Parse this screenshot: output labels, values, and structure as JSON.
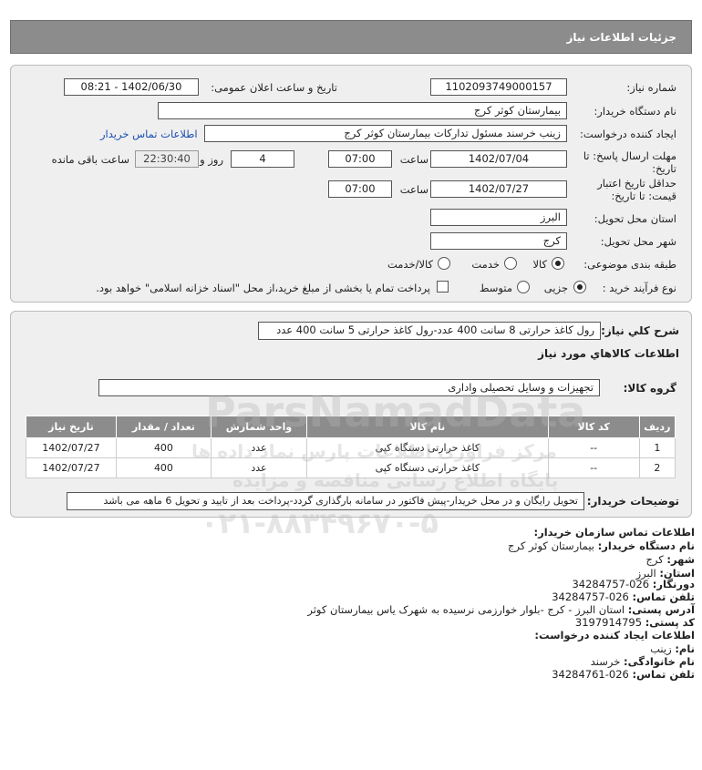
{
  "page": {
    "title": "جزئیات اطلاعات نیاز"
  },
  "form": {
    "need_number_label": "شماره نیاز:",
    "need_number": "1102093749000157",
    "announce_label": "تاریخ و ساعت اعلان عمومی:",
    "announce_value": "1402/06/30 - 08:21",
    "buyer_label": "نام دستگاه خریدار:",
    "buyer_value": "بیمارستان کوثر کرج",
    "creator_label": "ایجاد کننده درخواست:",
    "creator_value": "زینب خرسند مسئول تدارکات بیمارستان کوثر کرج",
    "contact_link": "اطلاعات تماس خریدار",
    "deadline_label": "مهلت ارسال پاسخ: تا تاریخ:",
    "deadline_date": "1402/07/04",
    "time_label": "ساعت",
    "deadline_time": "07:00",
    "days_value": "4",
    "days_label": "روز و",
    "remaining_time": "22:30:40",
    "remaining_label": "ساعت باقی مانده",
    "validity_label": "حداقل تاریخ اعتبار قیمت: تا تاریخ:",
    "validity_date": "1402/07/27",
    "validity_time": "07:00",
    "province_label": "استان محل تحویل:",
    "province_value": "البرز",
    "city_label": "شهر محل تحویل:",
    "city_value": "کرج",
    "category_label": "طبقه بندی موضوعی:",
    "category_options": [
      "کالا",
      "خدمت",
      "کالا/خدمت"
    ],
    "process_label": "نوع فرآیند خرید :",
    "process_options": [
      "جزیی",
      "متوسط"
    ],
    "payment_note": "پرداخت تمام یا بخشی از مبلغ خرید،از محل \"اسناد خزانه اسلامی\" خواهد بود."
  },
  "description": {
    "label": "شرح کلي نياز:",
    "value": "رول کاغذ حرارتی 8 سانت 400 عدد-رول کاغذ حرارتی 5 سانت 400 عدد"
  },
  "goods": {
    "section_title": "اطلاعات کالاهاي مورد نياز",
    "group_label": "گروه کالا:",
    "group_value": "تجهیزات و وسایل تحصیلی واداری",
    "headers": [
      "ردیف",
      "کد کالا",
      "نام کالا",
      "واحد شمارش",
      "تعداد / مقدار",
      "تاریخ نیاز"
    ],
    "rows": [
      [
        "1",
        "--",
        "کاغذ حرارتی دستگاه کپی",
        "عدد",
        "400",
        "1402/07/27"
      ],
      [
        "2",
        "--",
        "کاغذ حرارتی دستگاه کپی",
        "عدد",
        "400",
        "1402/07/27"
      ]
    ]
  },
  "buyer_notes": {
    "label": "توضیحات خریدار:",
    "value": "تحویل رایگان و در محل خریدار-پیش فاکتور در سامانه بارگذاری گردد-پرداخت بعد از تایید و تحویل 6 ماهه می باشد"
  },
  "contact": {
    "title": "اطلاعات تماس سازمان خریدار:",
    "buyer_name_label": "نام دستگاه خریدار:",
    "buyer_name": "بیمارستان کوثر کرج",
    "city_label": "شهر:",
    "city": "کرج",
    "province_label": "استان:",
    "province": "البرز",
    "fax_label": "دورنگار:",
    "fax": "026-34284757",
    "phone_label": "تلفن تماس:",
    "phone": "026-34284757",
    "address_label": "آدرس پستی:",
    "address": "استان البرز - کرج -بلوار خوارزمی نرسیده به شهرک یاس بیمارستان کوثر",
    "postal_label": "کد پستی:",
    "postal": "3197914795",
    "creator_title": "اطلاعات ایجاد کننده درخواست:",
    "first_name_label": "نام:",
    "first_name": "زینب",
    "last_name_label": "نام خانوادگی:",
    "last_name": "خرسند",
    "creator_phone_label": "تلفن تماس:",
    "creator_phone": "026-34284761"
  },
  "watermark": {
    "brand": "ParsNamadData",
    "brand_fa": "مرکز فراوری اطلاعات پارس نماد داده ها",
    "portal": "پایگاه اطلاع رسانی مناقصه و مزایده",
    "phone": "۰۲۱-۸۸۳۴۹۶۷۰-۵"
  }
}
